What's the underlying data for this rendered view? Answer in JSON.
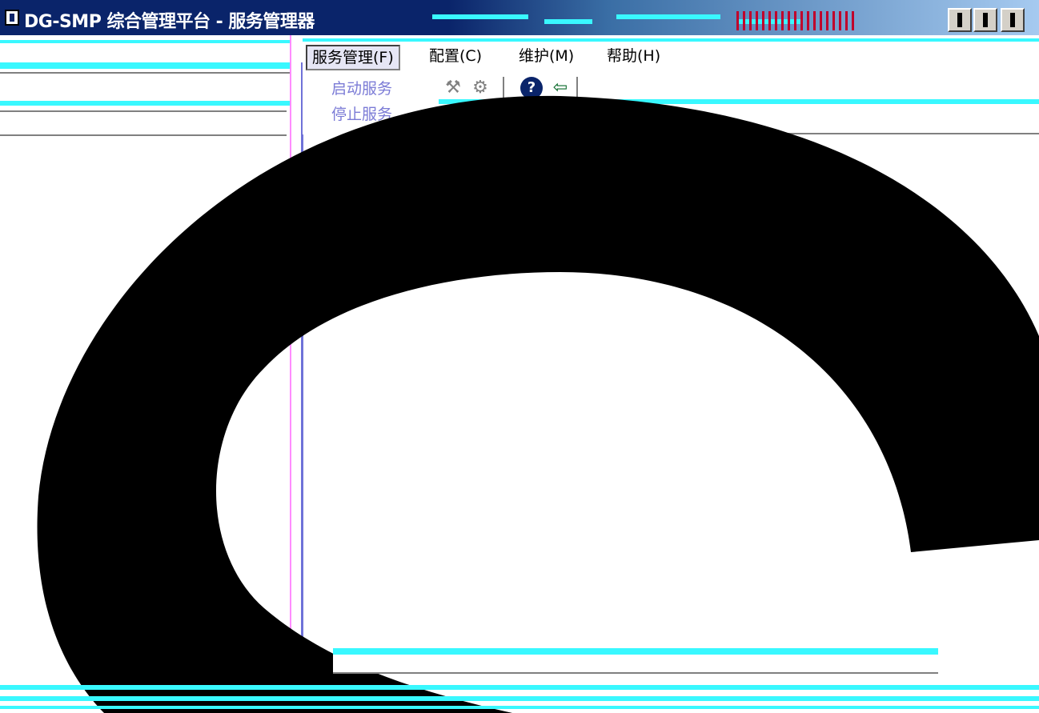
{
  "window": {
    "title": "DG-SMP 综合管理平台 - 服务管理器"
  },
  "menu": {
    "items": [
      {
        "label": "服务管理(F)",
        "active": true
      },
      {
        "label": "配置(C)",
        "active": false
      },
      {
        "label": "维护(M)",
        "active": false
      },
      {
        "label": "帮助(H)",
        "active": false
      }
    ]
  },
  "dropdown": {
    "items": [
      "启动服务",
      "停止服务"
    ]
  },
  "toolbar": {
    "icons": [
      "wrench-icon",
      "tools-icon",
      "help-icon",
      "exit-door-icon"
    ],
    "help_glyph": "?"
  },
  "colors": {
    "title_bar": "#0a246a",
    "accent_cyan": "#39f8ff",
    "accent_pink": "#ff8cff",
    "menu_text_disabled": "#7b7bd6"
  }
}
